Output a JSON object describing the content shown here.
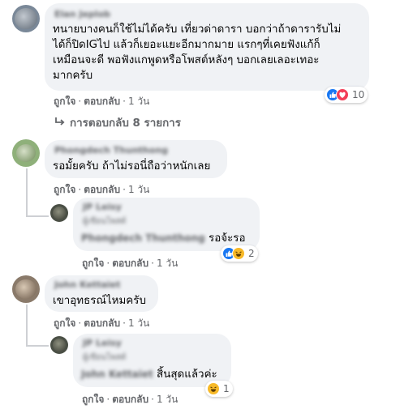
{
  "comments": [
    {
      "author": "Elan Jeplob",
      "lines": [
        "ทนายบางคนก็ใช้ไม่ได้ครับ เที่ยวด่าดารา บอกว่าถ้าดารารับไม่",
        "ได้ก็ปิดIGไป แล้วก็เยอะแยะอีกมากมาย แรกๆที่เคยฟังแก้ก็",
        "เหมือนจะดี พอฟังแกพูดหรือโพสต์หลังๆ บอกเลยเลอะเทอะ",
        "มากครับ"
      ],
      "like": "ถูกใจ",
      "reply": "ตอบกลับ",
      "time": "1 วัน",
      "reaction_count": "10",
      "view_replies": "การตอบกลับ 8 รายการ"
    },
    {
      "author": "Phongdech Thunthong",
      "lines": [
        "รอมั้ยครับ ถ้าไม่รอนี่ถือว่าหนักเลย"
      ],
      "like": "ถูกใจ",
      "reply": "ตอบกลับ",
      "time": "1 วัน"
    },
    {
      "author": "JP Leisy",
      "meta": "ผู้เขียนโพสต์",
      "mention": "Phongdech Thunthong",
      "text": " รอจ้ะรอ",
      "like": "ถูกใจ",
      "reply": "ตอบกลับ",
      "time": "1 วัน",
      "reaction_count": "2"
    },
    {
      "author": "John Kettaiet",
      "lines": [
        "เขาอุทธรณ์ไหมครับ"
      ],
      "like": "ถูกใจ",
      "reply": "ตอบกลับ",
      "time": "1 วัน"
    },
    {
      "author": "JP Leisy",
      "meta": "ผู้เขียนโพสต์",
      "mention": "John Kettaiet",
      "text": " สิ้นสุดแล้วค่ะ",
      "like": "ถูกใจ",
      "reply": "ตอบกลับ",
      "time": "1 วัน",
      "reaction_count": "1"
    }
  ],
  "sep": "·",
  "colors": {
    "like_blue": "#1877f2",
    "love_red": "#f33e58",
    "haha_yellow": "#f7b928"
  }
}
